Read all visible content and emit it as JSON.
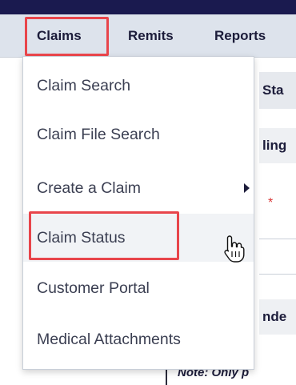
{
  "nav": {
    "claims_label": "Claims",
    "remits_label": "Remits",
    "reports_label": "Reports"
  },
  "claims_menu": {
    "items": [
      {
        "label": "Claim Search"
      },
      {
        "label": "Claim File Search"
      },
      {
        "label": "Create a Claim",
        "submenu_icon": "chevron-right-icon"
      },
      {
        "label": "Claim Status",
        "state": "hovered"
      },
      {
        "label": "Customer Portal"
      },
      {
        "label": "Medical Attachments"
      }
    ]
  },
  "background_page": {
    "fragment_sta": "Sta",
    "fragment_ling": "ling",
    "required_marker": "*",
    "fragment_nde": "nde",
    "note_text": "Note: Only p"
  },
  "colors": {
    "top_bar": "#1a1a4f",
    "nav_bar": "#dde3ec",
    "highlight_box": "#e8454b",
    "menu_text": "#3b3f52"
  },
  "icons": {
    "pointer": "hand-pointer-icon"
  }
}
